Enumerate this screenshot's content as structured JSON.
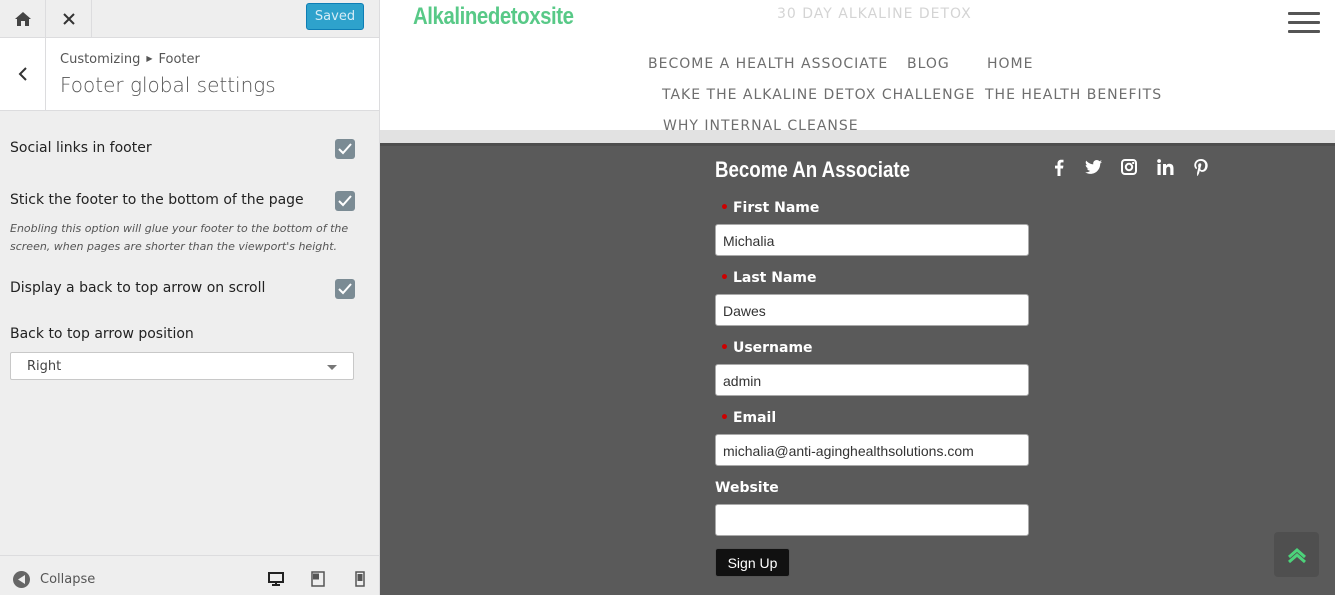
{
  "topbar": {
    "saved_label": "Saved",
    "home_icon": "home-icon",
    "close_icon": "close-icon"
  },
  "section": {
    "breadcrumb_root": "Customizing",
    "breadcrumb_current": "Footer",
    "title": "Footer global settings"
  },
  "controls": [
    {
      "label": "Social links in footer",
      "checked": true
    },
    {
      "label": "Stick the footer to the bottom of the page",
      "checked": true,
      "description": "Enobling this option will glue your footer to the bottom of the screen, when pages are shorter than the viewport's height."
    },
    {
      "label": "Display a back to top arrow on scroll",
      "checked": true
    }
  ],
  "arrow_position": {
    "label": "Back to top arrow position",
    "selected": "Right"
  },
  "footerbar": {
    "collapse_label": "Collapse"
  },
  "site": {
    "logo": "Alkalinedetoxsite",
    "tagline": "30 DAY ALKALINE DETOX",
    "nav": [
      "BECOME A HEALTH ASSOCIATE",
      "BLOG",
      "HOME",
      "TAKE THE ALKALINE DETOX CHALLENGE",
      "THE HEALTH BENEFITS",
      "WHY INTERNAL CLEANSE"
    ]
  },
  "form": {
    "title": "Become An Associate",
    "fields": [
      {
        "label": "First Name",
        "required": true,
        "value": "Michalia"
      },
      {
        "label": "Last Name",
        "required": true,
        "value": "Dawes"
      },
      {
        "label": "Username",
        "required": true,
        "value": "admin"
      },
      {
        "label": "Email",
        "required": true,
        "value": "michalia@anti-aginghealthsolutions.com"
      },
      {
        "label": "Website",
        "required": false,
        "value": ""
      }
    ],
    "submit_label": "Sign Up"
  },
  "social_icons": [
    "facebook-icon",
    "twitter-icon",
    "instagram-icon",
    "linkedin-icon",
    "pinterest-icon"
  ],
  "colors": {
    "accent": "#2ea2cc",
    "logo_green": "#58c987",
    "footer_bg": "#5a5a5a",
    "totop_arrow": "#4cd37a"
  }
}
